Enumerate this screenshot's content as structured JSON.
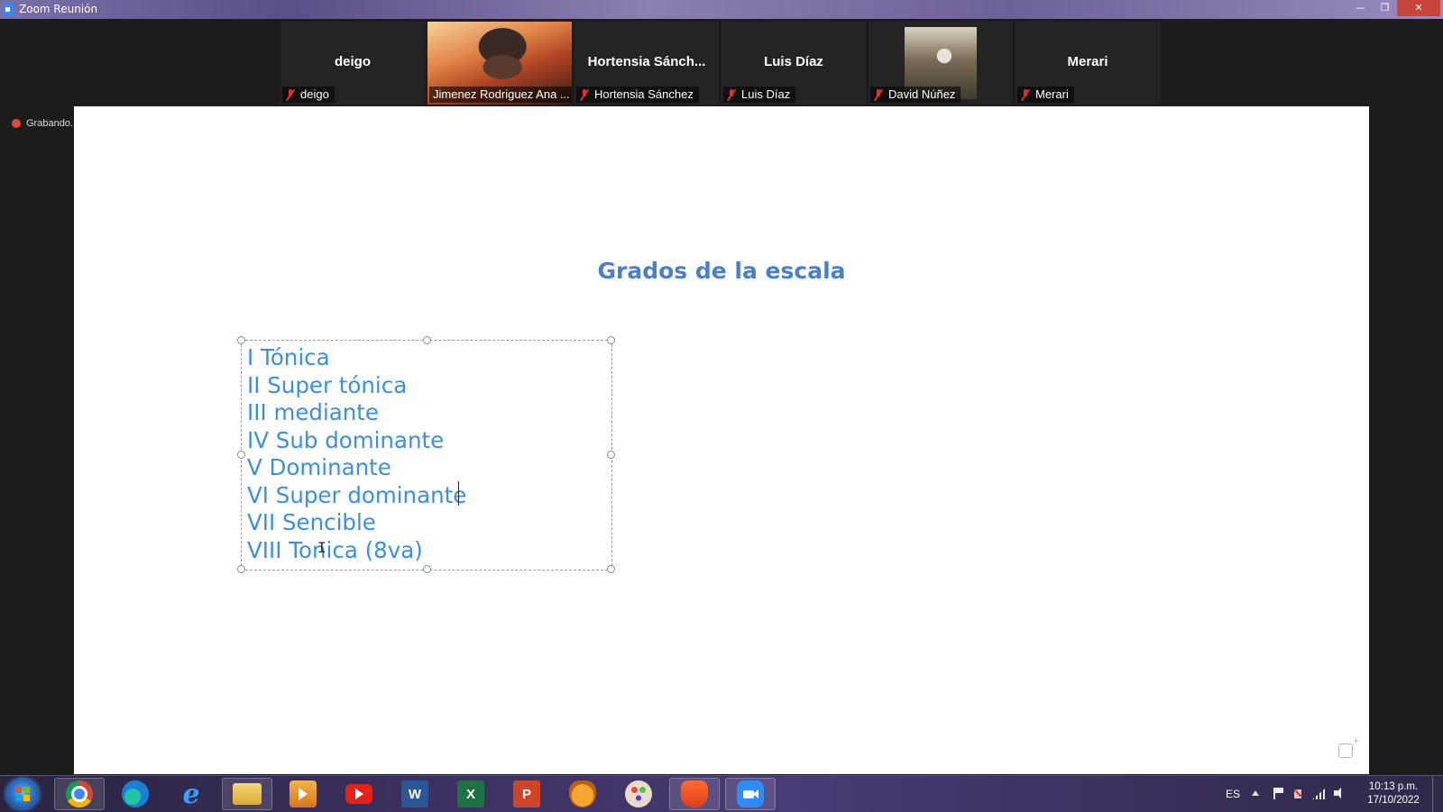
{
  "window": {
    "title": "Zoom Reunión",
    "minimize_glyph": "—",
    "maximize_glyph": "❐",
    "close_glyph": "✕"
  },
  "participants": [
    {
      "name": "deigo",
      "label": "deigo",
      "video": false,
      "muted": true
    },
    {
      "name": "",
      "label": "Jimenez Rodriguez Ana ...",
      "video": true,
      "muted": false,
      "active_speaker": true
    },
    {
      "name": "Hortensia  Sánch...",
      "label": "Hortensia Sánchez",
      "video": false,
      "muted": true
    },
    {
      "name": "Luis Díaz",
      "label": "Luis Díaz",
      "video": false,
      "muted": true
    },
    {
      "name": "",
      "label": "David Núñez",
      "video": true,
      "muted": true
    },
    {
      "name": "Merari",
      "label": "Merari",
      "video": false,
      "muted": true
    }
  ],
  "recording": {
    "label": "Grabando..."
  },
  "slide": {
    "title": "Grados de la escala",
    "degrees": [
      "I Tónica",
      "II Super tónica",
      "III mediante",
      "IV Sub dominante",
      "V Dominante",
      "VI Super dominante",
      "VII Sencible",
      "VIII Tonica (8va)"
    ]
  },
  "taskbar": {
    "apps": [
      "chrome-icon",
      "edge-icon",
      "internet-explorer-icon",
      "file-explorer-icon",
      "media-player-icon",
      "youtube-icon",
      "word-icon",
      "excel-icon",
      "powerpoint-icon",
      "fl-studio-icon",
      "paint-icon",
      "brave-icon",
      "zoom-icon"
    ],
    "word_letter": "W",
    "excel_letter": "X",
    "ppt_letter": "P",
    "ie_letter": "e",
    "language": "ES",
    "time": "10:13 p.m.",
    "date": "17/10/2022"
  },
  "colors": {
    "slide_text": "#3b8fe0",
    "title_text": "#4a7fc9",
    "active_speaker_border": "#9ad14b",
    "muted_icon": "#e03030"
  }
}
